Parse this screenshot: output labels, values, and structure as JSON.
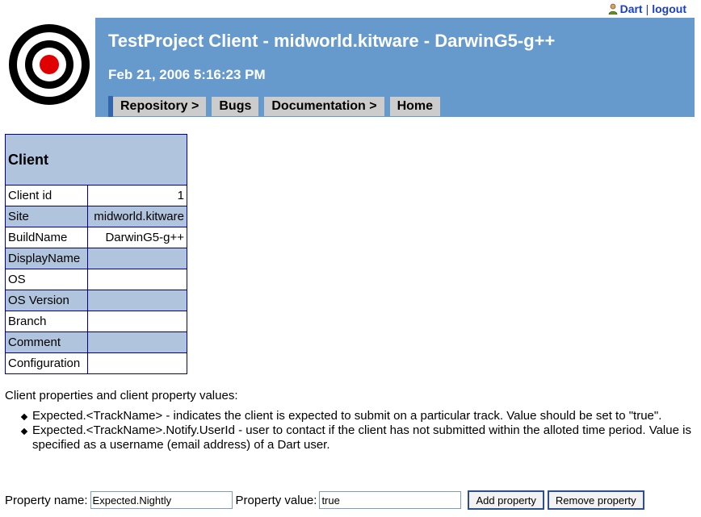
{
  "user": {
    "name": "Dart",
    "separator": "|",
    "logout": "logout"
  },
  "banner": {
    "title": "TestProject Client - midworld.kitware - DarwinG5-g++",
    "date": "Feb 21, 2006 5:16:23 PM",
    "nav": [
      "Repository >",
      "Bugs",
      "Documentation >",
      "Home"
    ]
  },
  "client": {
    "header": "Client",
    "rows": [
      {
        "label": "Client id",
        "value": "1"
      },
      {
        "label": "Site",
        "value": "midworld.kitware"
      },
      {
        "label": "BuildName",
        "value": "DarwinG5-g++"
      },
      {
        "label": "DisplayName",
        "value": ""
      },
      {
        "label": "OS",
        "value": ""
      },
      {
        "label": "OS Version",
        "value": ""
      },
      {
        "label": "Branch",
        "value": ""
      },
      {
        "label": "Comment",
        "value": ""
      },
      {
        "label": "Configuration",
        "value": ""
      }
    ]
  },
  "properties": {
    "intro": "Client properties and client property values:",
    "items": [
      "Expected.<TrackName> - indicates the client is expected to submit on a particular track. Value should be set to \"true\".",
      "Expected.<TrackName>.Notify.UserId - user to contact if the client has not submitted within the alloted time period. Value is specified as a username (email address) of a Dart user."
    ]
  },
  "form": {
    "name_label": "Property name:",
    "name_value": "Expected.Nightly",
    "value_label": "Property value:",
    "value_value": "true",
    "add_button": "Add property",
    "remove_button": "Remove property"
  },
  "colors": {
    "banner": "#6699cc",
    "header_cell": "#b0c4de",
    "nav_button": "#cccccc",
    "link": "#1a3fbf"
  }
}
